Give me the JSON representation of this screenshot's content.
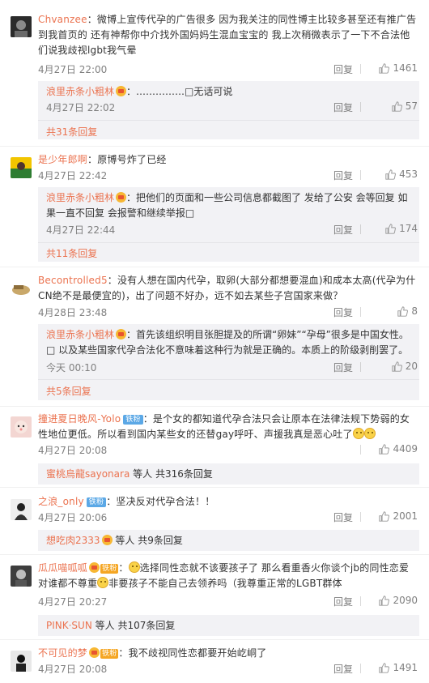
{
  "labels": {
    "reply": "回复"
  },
  "comments": [
    {
      "user": "Chvanzee",
      "text": "：微博上宣传代孕的广告很多 因为我关注的同性博主比较多甚至还有推广告到我首页的 还有神帮你中介找外国妈妈生混血宝宝的 我上次稍微表示了一下不合法他们说我歧视lgbt我气晕",
      "time": "4月27日 22:00",
      "likes": "1461",
      "replies": [
        {
          "user": "浪里赤条小粗林",
          "text": "：……………□无话可说",
          "time": "4月27日 22:02",
          "likes": "57"
        }
      ],
      "more": "共31条回复"
    },
    {
      "user": "是少年郎啊",
      "text": "：原博号炸了已经",
      "time": "4月27日 22:42",
      "likes": "453",
      "replies": [
        {
          "user": "浪里赤条小粗林",
          "text": "：把他们的页面和一些公司信息都截图了 发给了公安 会等回复 如果一直不回复 会报警和继续举报□",
          "time": "4月27日 22:44",
          "likes": "174"
        }
      ],
      "more": "共11条回复"
    },
    {
      "user": "Becontrolled5",
      "text": "：没有人想在国内代孕，取卵(大部分都想要混血)和成本太高(代孕为什CN绝不是最便宜的)，出了问题不好办，远不如去某些子宫国家来做？",
      "time": "4月28日 23:48",
      "likes": "8",
      "replies": [
        {
          "user": "浪里赤条小粗林",
          "text": "：首先该组织明目张胆提及的所谓“卵妹”“孕母”很多是中国女性。□ 以及某些国家代孕合法化不意味着这种行为就是正确的。本质上的阶级剥削罢了。",
          "time": "今天 00:10",
          "likes": "20"
        }
      ],
      "more": "共5条回复"
    },
    {
      "user": "撞进夏日晚风-Yolo",
      "tag": "铁粉",
      "text": "：是个女的都知道代孕合法只会让原本在法律法规下势弱的女性地位更低。所以看到国内某些女的还替gay呼吁、声援我真是恶心吐了",
      "time": "4月27日 20:08",
      "likes": "4409",
      "more_user": "蜜桃烏龍sayonara",
      "more": "等人 共316条回复"
    },
    {
      "user": "之浪_only",
      "tag": "铁粉",
      "text": "：坚决反对代孕合法！！",
      "time": "4月27日 20:06",
      "likes": "2001",
      "more_user": "想吃肉2333",
      "more": "等人 共9条回复"
    },
    {
      "user": "瓜瓜喵呱呱",
      "tag": "铁粉",
      "text_a": "：",
      "text_b": "选择同性恋就不该要孩子了 那么看重香火你谈个jb的同性恋爱 对谁都不尊重",
      "text_c": "非要孩子不能自己去领养吗（我尊重正常的LGBT群体",
      "time": "4月27日 20:27",
      "likes": "2090",
      "more_user": "PINK·SUN",
      "more": "等人 共107条回复"
    },
    {
      "user": "不可见的梦",
      "tag": "铁粉",
      "text": "：我不歧视同性恋都要开始屹峒了",
      "time": "4月27日 20:08",
      "likes": "1491"
    }
  ]
}
